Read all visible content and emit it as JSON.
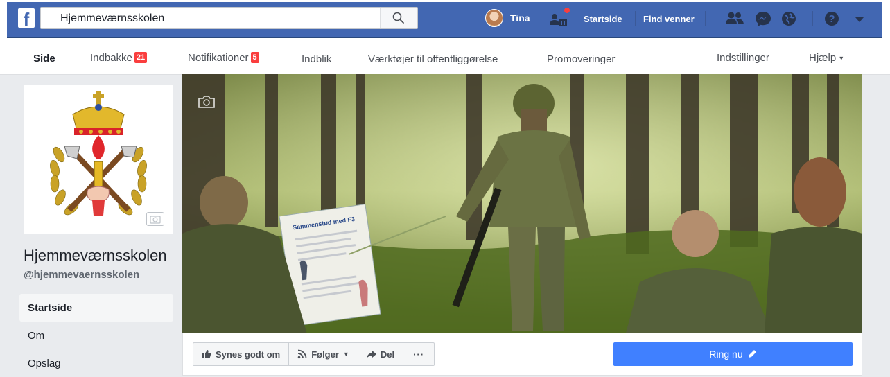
{
  "topbar": {
    "logo": "f",
    "search_value": "Hjemmeværnsskolen",
    "profile_name": "Tina",
    "links": [
      "Startside",
      "Find venner"
    ],
    "accent_color": "#4267b2",
    "icons": [
      "search-icon",
      "friend-requests-icon",
      "friends-icon",
      "messenger-icon",
      "globe-notifications-icon",
      "help-icon",
      "caret-down-icon"
    ]
  },
  "tabs": {
    "side": "Side",
    "indbakke": "Indbakke",
    "indbakke_badge": "21",
    "notifikationer": "Notifikationer",
    "notifikationer_badge": "5",
    "indblik": "Indblik",
    "vaerktoejer": "Værktøjer til offentliggørelse",
    "promoveringer": "Promoveringer",
    "indstillinger": "Indstillinger",
    "hjaelp": "Hjælp",
    "caret": "▾"
  },
  "page": {
    "name": "Hjemmeværnsskolen",
    "handle": "@hjemmevaernsskolen"
  },
  "left_nav": [
    "Startside",
    "Om",
    "Opslag"
  ],
  "cover": {
    "sign_title": "Sammenstød med F3"
  },
  "actions": {
    "like": "Synes godt om",
    "follow": "Følger",
    "share": "Del",
    "more": "···",
    "call": "Ring nu"
  }
}
